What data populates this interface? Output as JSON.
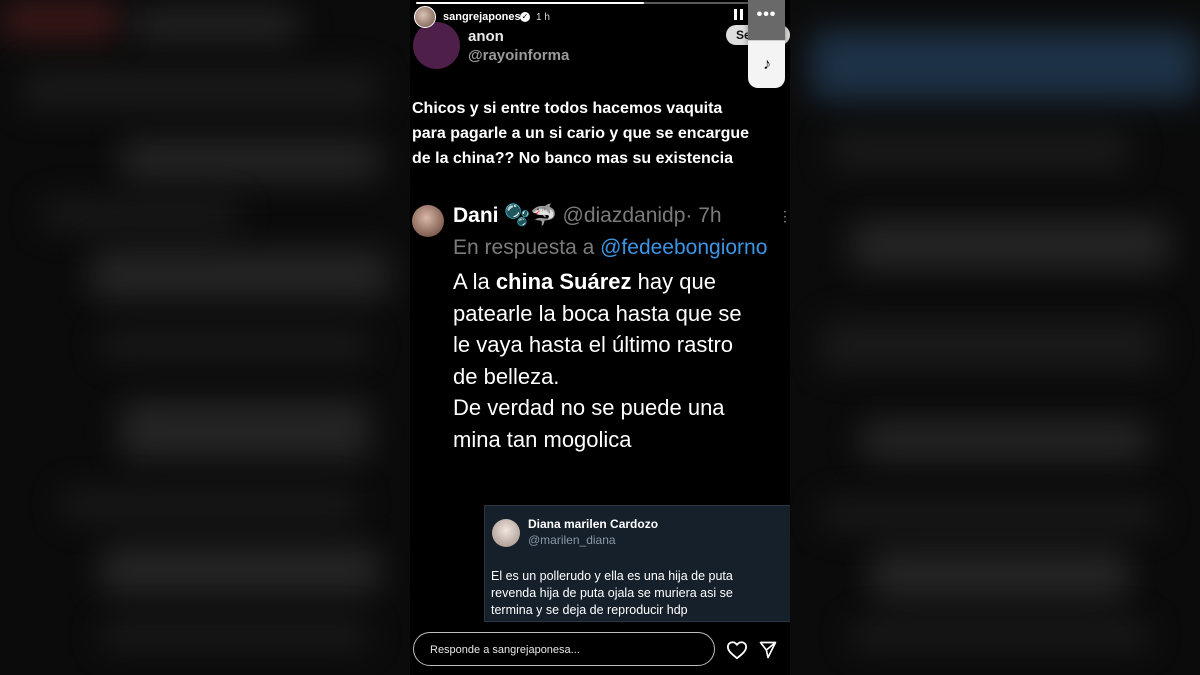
{
  "story": {
    "username": "sangrejaponesa",
    "time": "1 h",
    "progress": 0.62,
    "follow_label": "Seguir",
    "menu_dots": "•••",
    "reply_placeholder": "Responde a sangrejaponesa..."
  },
  "anon": {
    "name": "anon",
    "handle": "@rayoinforma",
    "post_text": "Chicos y si entre todos hacemos vaquita\npara pagarle a un si cario y que se encargue\nde la china?? No banco mas su existencia"
  },
  "tweet": {
    "name": "Dani",
    "emoji": "🫧🦈",
    "handle": "@diazdanidp",
    "time": "· 7h",
    "reply_prefix": "En respuesta a",
    "reply_mention": "@fedeebongiorno",
    "body_line1_pre": "A la ",
    "body_line1_bold": "china Suárez",
    "body_line1_post": " hay que",
    "body_rest": "patearle la boca hasta que se\nle vaya hasta el último rastro\nde belleza.\nDe verdad no se puede una\nmina tan mogolica"
  },
  "card": {
    "name": "Diana marilen Cardozo",
    "handle": "@marilen_diana",
    "text": "El es un pollerudo y ella es una hija de puta\nrevenda hija de puta ojala se muriera asi se\ntermina y se deja de reproducir hdp"
  },
  "colors": {
    "mention_blue": "#3c95e4",
    "card_bg": "#15202b",
    "anon_avatar": "#4e1f49"
  }
}
